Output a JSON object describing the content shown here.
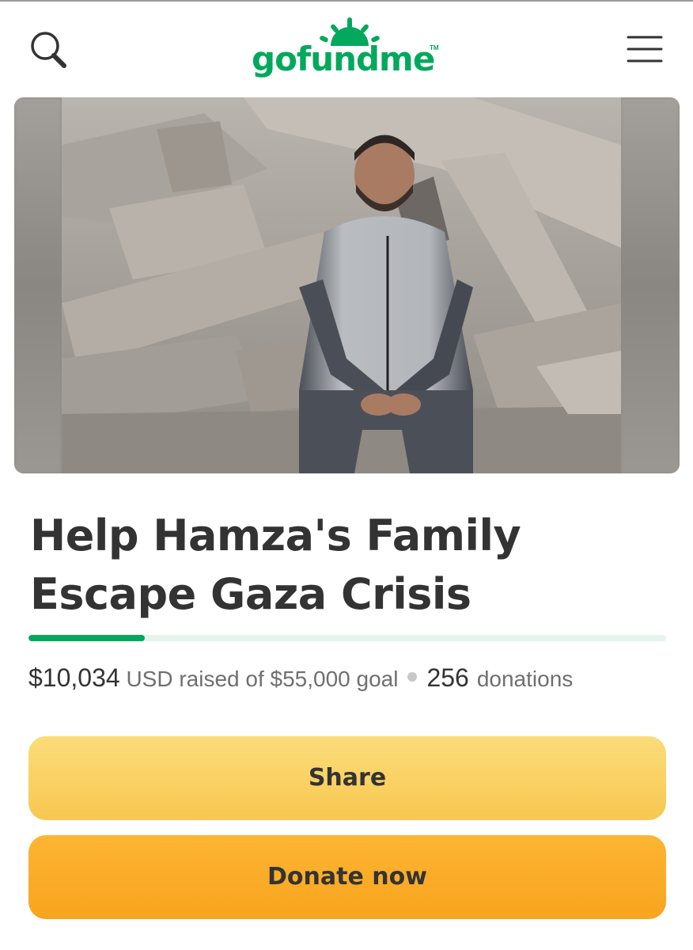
{
  "header": {
    "logo_text": "gofundme",
    "logo_tm": "TM",
    "search_icon": "search-icon",
    "menu_icon": "hamburger-menu-icon",
    "brand_color": "#02a95c"
  },
  "hero": {
    "alt": "Man sitting on rubble of destroyed building"
  },
  "campaign": {
    "title": "Help Hamza's Family Escape Gaza Crisis",
    "raised_amount": "$10,034",
    "raised_text": "USD raised of $55,000 goal",
    "donations_count": "256",
    "donations_label": "donations",
    "progress_percent": 18.2
  },
  "actions": {
    "share_label": "Share",
    "donate_label": "Donate now"
  }
}
